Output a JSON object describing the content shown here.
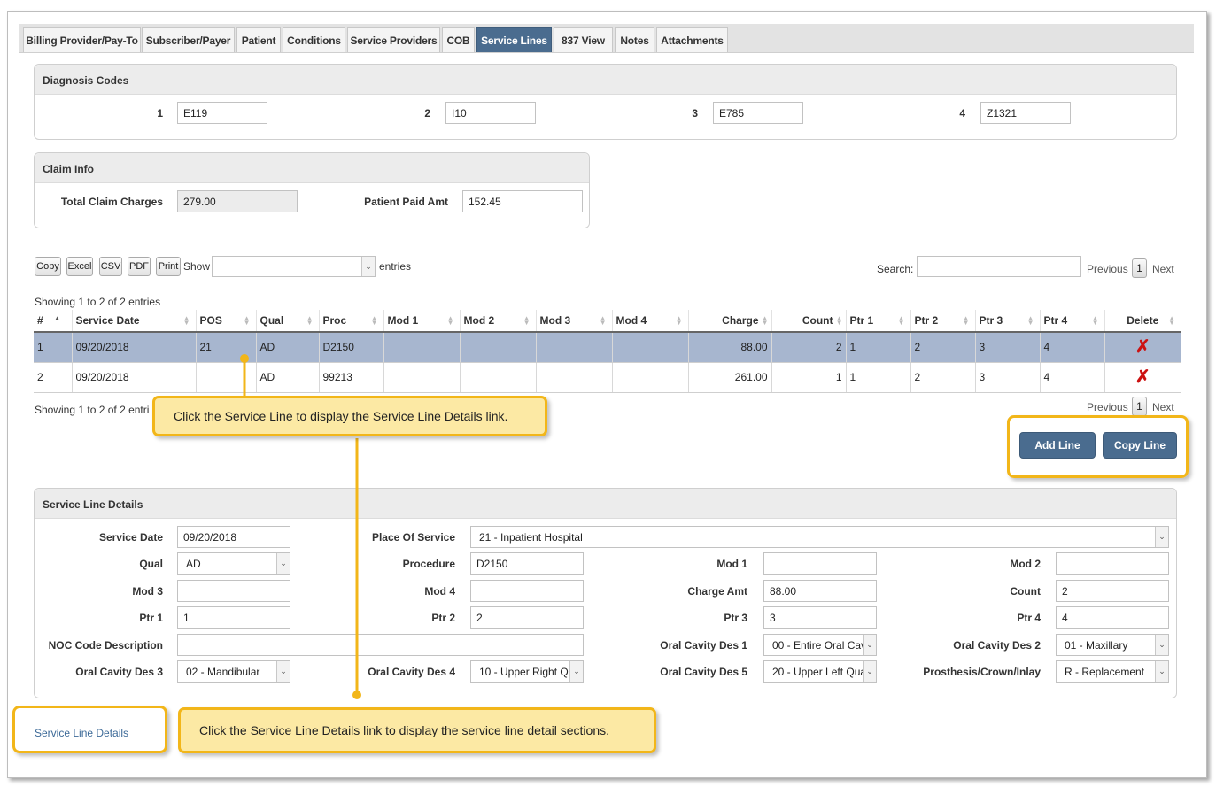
{
  "tabs": [
    "Billing Provider/Pay-To",
    "Subscriber/Payer",
    "Patient",
    "Conditions",
    "Service Providers",
    "COB",
    "Service Lines",
    "837 View",
    "Notes",
    "Attachments"
  ],
  "diagnosis": {
    "title": "Diagnosis Codes",
    "codes": [
      {
        "label": "1",
        "value": "E119"
      },
      {
        "label": "2",
        "value": "I10"
      },
      {
        "label": "3",
        "value": "E785"
      },
      {
        "label": "4",
        "value": "Z1321"
      }
    ]
  },
  "claim_info": {
    "title": "Claim Info",
    "total_label": "Total Claim Charges",
    "total_value": "279.00",
    "paid_label": "Patient Paid Amt",
    "paid_value": "152.45"
  },
  "toolbar": {
    "copy": "Copy",
    "excel": "Excel",
    "csv": "CSV",
    "pdf": "PDF",
    "print": "Print",
    "show": "Show",
    "entries": "entries",
    "search": "Search:",
    "previous": "Previous",
    "page": "1",
    "next": "Next",
    "showing": "Showing 1 to 2 of 2 entries",
    "showing_bottom": "Showing 1 to 2 of 2 entri"
  },
  "table": {
    "columns": [
      "#",
      "Service Date",
      "POS",
      "Qual",
      "Proc",
      "Mod 1",
      "Mod 2",
      "Mod 3",
      "Mod 4",
      "Charge",
      "Count",
      "Ptr 1",
      "Ptr 2",
      "Ptr 3",
      "Ptr 4",
      "Delete"
    ],
    "rows": [
      [
        "1",
        "09/20/2018",
        "21",
        "AD",
        "D2150",
        "",
        "",
        "",
        "",
        "88.00",
        "2",
        "1",
        "2",
        "3",
        "4"
      ],
      [
        "2",
        "09/20/2018",
        "",
        "AD",
        "99213",
        "",
        "",
        "",
        "",
        "261.00",
        "1",
        "1",
        "2",
        "3",
        "4"
      ]
    ],
    "delete_icon": "✗"
  },
  "buttons": {
    "add_line": "Add Line",
    "copy_line": "Copy Line"
  },
  "details": {
    "title": "Service Line Details",
    "service_date_label": "Service Date",
    "service_date": "09/20/2018",
    "pos_label": "Place Of Service",
    "pos": "21 - Inpatient Hospital",
    "qual_label": "Qual",
    "qual": "AD",
    "procedure_label": "Procedure",
    "procedure": "D2150",
    "mod1_label": "Mod 1",
    "mod1": "",
    "mod2_label": "Mod 2",
    "mod2": "",
    "mod3_label": "Mod 3",
    "mod3": "",
    "mod4_label": "Mod 4",
    "mod4": "",
    "charge_label": "Charge Amt",
    "charge": "88.00",
    "count_label": "Count",
    "count": "2",
    "ptr1_label": "Ptr 1",
    "ptr1": "1",
    "ptr2_label": "Ptr 2",
    "ptr2": "2",
    "ptr3_label": "Ptr 3",
    "ptr3": "3",
    "ptr4_label": "Ptr 4",
    "ptr4": "4",
    "noc_label": "NOC Code Description",
    "noc": "",
    "ocd1_label": "Oral Cavity Des 1",
    "ocd1": "00 - Entire Oral Cavi",
    "ocd2_label": "Oral Cavity Des 2",
    "ocd2": "01 - Maxillary",
    "ocd3_label": "Oral Cavity Des 3",
    "ocd3": "02 - Mandibular",
    "ocd4_label": "Oral Cavity Des 4",
    "ocd4": "10 - Upper Right Qu",
    "ocd5_label": "Oral Cavity Des 5",
    "ocd5": "20 - Upper Left Qua",
    "pci_label": "Prosthesis/Crown/Inlay",
    "pci": "R - Replacement"
  },
  "link": {
    "service_line_details": "Service Line Details"
  },
  "callouts": {
    "top": "Click the Service Line to display the Service Line Details link.",
    "bottom": "Click the Service Line Details link to display the  service line detail sections."
  },
  "colors": {
    "accent": "#4a6c8f",
    "callout_border": "#f2b619",
    "callout_fill": "#fce9a4",
    "selected_row": "#a7b6cf"
  }
}
